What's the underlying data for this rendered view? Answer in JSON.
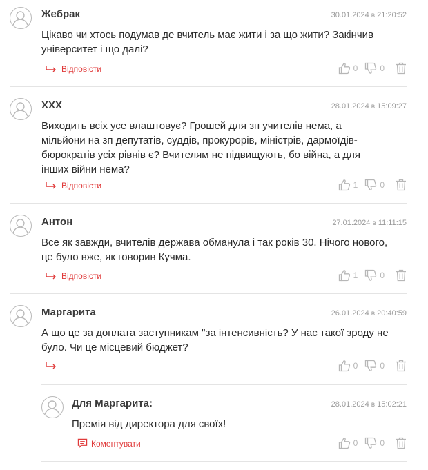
{
  "comments": [
    {
      "author": "Жебрак",
      "date": "30.01.2024",
      "time_sep": "в",
      "time": "21:20:52",
      "text": "Цікаво чи хтось подумав де вчитель має жити і за що жити? Закінчив університет і що далі?",
      "reply_label": "Відповісти",
      "likes": "0",
      "dislikes": "0"
    },
    {
      "author": "XXX",
      "date": "28.01.2024",
      "time_sep": "в",
      "time": "15:09:27",
      "text": "Виходить всіх усе влаштовує? Грошей для зп учителів нема, а мільйони на зп депутатів, суддів, прокурорів, міністрів, дармоїдів-бюрократів усіх рівнів є? Вчителям не підвищують, бо війна, а для інших війни нема?",
      "reply_label": "Відповісти",
      "likes": "1",
      "dislikes": "0"
    },
    {
      "author": "Антон",
      "date": "27.01.2024",
      "time_sep": "в",
      "time": "11:11:15",
      "text": "Все як завжди, вчителів держава обманула і так років 30. Нічого нового, це було вже, як говорив Кучма.",
      "reply_label": "Відповісти",
      "likes": "1",
      "dislikes": "0"
    },
    {
      "author": "Маргарита",
      "date": "26.01.2024",
      "time_sep": "в",
      "time": "20:40:59",
      "text": "А що це за доплата заступникам \"за інтенсивність? У нас такої зроду не було. Чи це місцевий бюджет?",
      "reply_label": "",
      "likes": "0",
      "dislikes": "0"
    }
  ],
  "nested": {
    "author": "Для Маргарита:",
    "date": "28.01.2024",
    "time_sep": "в",
    "time": "15:02:21",
    "text": "Премія від директора для своїх!",
    "comment_label": "Коментувати",
    "likes": "0",
    "dislikes": "0"
  },
  "colors": {
    "accent": "#e03a3a",
    "muted": "#b7b7b7",
    "separator": "#e4e4e4"
  }
}
